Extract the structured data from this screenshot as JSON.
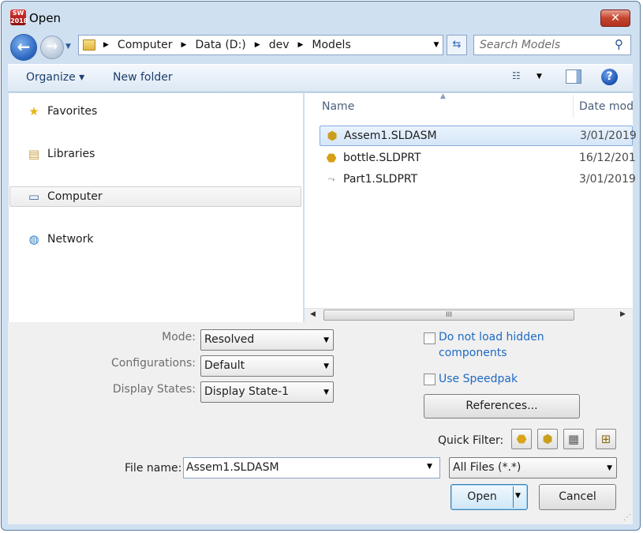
{
  "window": {
    "title": "Open",
    "app_icon_text": "SW 2018",
    "close_glyph": "✕"
  },
  "address": {
    "crumbs": [
      "Computer",
      "Data (D:)",
      "dev",
      "Models"
    ],
    "separator": "▶",
    "search_placeholder": "Search Models"
  },
  "toolbar": {
    "organize_label": "Organize ▾",
    "new_folder_label": "New folder",
    "help_glyph": "?"
  },
  "nav": {
    "items": [
      {
        "label": "Favorites",
        "icon": "star-icon"
      },
      {
        "label": "Libraries",
        "icon": "libraries-icon"
      },
      {
        "label": "Computer",
        "icon": "computer-icon"
      },
      {
        "label": "Network",
        "icon": "network-icon"
      }
    ]
  },
  "files": {
    "headers": {
      "name": "Name",
      "date": "Date mod"
    },
    "rows": [
      {
        "name": "Assem1.SLDASM",
        "date": "3/01/2019",
        "icon": "assembly-icon",
        "selected": true
      },
      {
        "name": "bottle.SLDPRT",
        "date": "16/12/201",
        "icon": "part-icon",
        "selected": false
      },
      {
        "name": "Part1.SLDPRT",
        "date": "3/01/2019",
        "icon": "part-file-icon",
        "selected": false
      }
    ],
    "scroll_thumb_grip": "III"
  },
  "options": {
    "mode_label": "Mode:",
    "mode_value": "Resolved",
    "configurations_label": "Configurations:",
    "configurations_value": "Default",
    "display_states_label": "Display States:",
    "display_states_value": "Display State-1",
    "hidden_components_line1": "Do not load hidden",
    "hidden_components_line2": "components",
    "hidden_components_checked": false,
    "speedpak_label": "Use Speedpak",
    "speedpak_checked": false,
    "references_button": "References...",
    "quick_filter_label": "Quick Filter:"
  },
  "footer": {
    "file_name_label": "File name:",
    "file_name_value": "Assem1.SLDASM",
    "file_type_value": "All Files (*.*)",
    "open_button": "Open",
    "cancel_button": "Cancel"
  },
  "colors": {
    "frame": "#cfe0f1",
    "selection": "#d5e6f8",
    "link": "#1e6ac4",
    "close": "#c4452e"
  }
}
